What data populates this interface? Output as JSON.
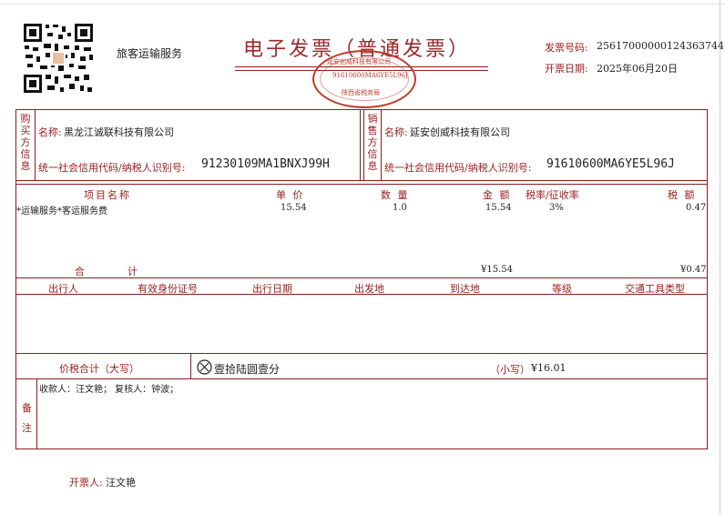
{
  "header": {
    "service_type": "旅客运输服务",
    "title": "电子发票（普通发票）",
    "invoice_no_label": "发票号码:",
    "invoice_no": "25617000000124363744",
    "issue_date_label": "开票日期:",
    "issue_date": "2025年06月20日"
  },
  "stamp": {
    "top_text": "延安创威科技有限公司",
    "code": "91610600MA6YE5L96J",
    "bottom_text": "陕西省税务局"
  },
  "buyer": {
    "side_label": "购买方信息",
    "name_label": "名称:",
    "name": "黑龙江诚联科技有限公司",
    "tax_label": "统一社会信用代码/纳税人识别号:",
    "tax_id": "91230109MA1BNXJ99H"
  },
  "seller": {
    "side_label": "销售方信息",
    "name_label": "名称:",
    "name": "延安创威科技有限公司",
    "tax_label": "统一社会信用代码/纳税人识别号:",
    "tax_id": "91610600MA6YE5L96J"
  },
  "items": {
    "headers": {
      "name": "项目名称",
      "unit_price": "单 价",
      "quantity": "数 量",
      "amount": "金 额",
      "rate": "税率/征收率",
      "tax": "税 额"
    },
    "rows": [
      {
        "name": "*运输服务*客运服务费",
        "unit_price": "15.54",
        "quantity": "1.0",
        "amount": "15.54",
        "rate": "3%",
        "tax": "0.47"
      }
    ],
    "total_label_1": "合",
    "total_label_2": "计",
    "total_amount": "¥15.54",
    "total_tax": "¥0.47"
  },
  "travel": {
    "headers": [
      "出行人",
      "有效身份证号",
      "出行日期",
      "出发地",
      "到达地",
      "等级",
      "交通工具类型"
    ]
  },
  "sum": {
    "label": "价税合计（大写）",
    "upper": "壹拾陆圆壹分",
    "lower_label": "（小写）",
    "lower": "¥16.01"
  },
  "remarks": {
    "label_1": "备",
    "label_2": "注",
    "text": "收款人：汪文艳；  复核人：钟波；"
  },
  "footer": {
    "issuer_label": "开票人:",
    "issuer": "汪文艳"
  },
  "colors": {
    "line": "#8b1e1e",
    "stamp": "#c0392b",
    "title": "#9b2a2a"
  }
}
